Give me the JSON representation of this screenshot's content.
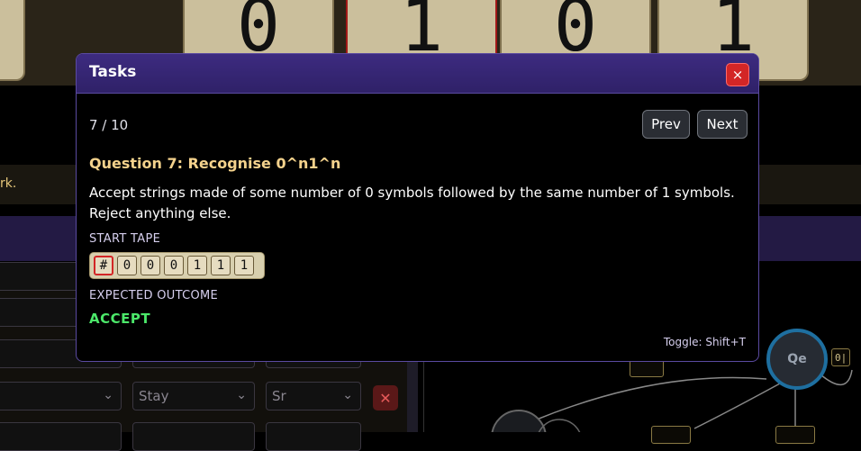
{
  "background": {
    "tape_symbols": [
      "1",
      "0",
      "1",
      "0",
      "1"
    ],
    "hint_text": "rk.",
    "rows": [
      {
        "dir": "Stay",
        "symbol": "Sr"
      }
    ],
    "nodes": [
      "Qe"
    ],
    "edge_labels": [
      "0|"
    ]
  },
  "modal": {
    "title": "Tasks",
    "close_symbol": "×",
    "counter": "7 / 10",
    "prev_label": "Prev",
    "next_label": "Next",
    "question_title": "Question 7: Recognise 0^n1^n",
    "description": "Accept strings made of some number of 0 symbols followed by the same number of 1 symbols. Reject anything else.",
    "start_tape_label": "START TAPE",
    "start_tape": [
      "#",
      "0",
      "0",
      "0",
      "1",
      "1",
      "1"
    ],
    "head_index": 0,
    "expected_label": "EXPECTED OUTCOME",
    "expected_value": "ACCEPT",
    "toggle_hint": "Toggle: Shift+T"
  },
  "colors": {
    "modal_header": "#3d2b80",
    "accept": "#4ce86a",
    "question_title": "#f4d28c",
    "close_button": "#d32626"
  }
}
